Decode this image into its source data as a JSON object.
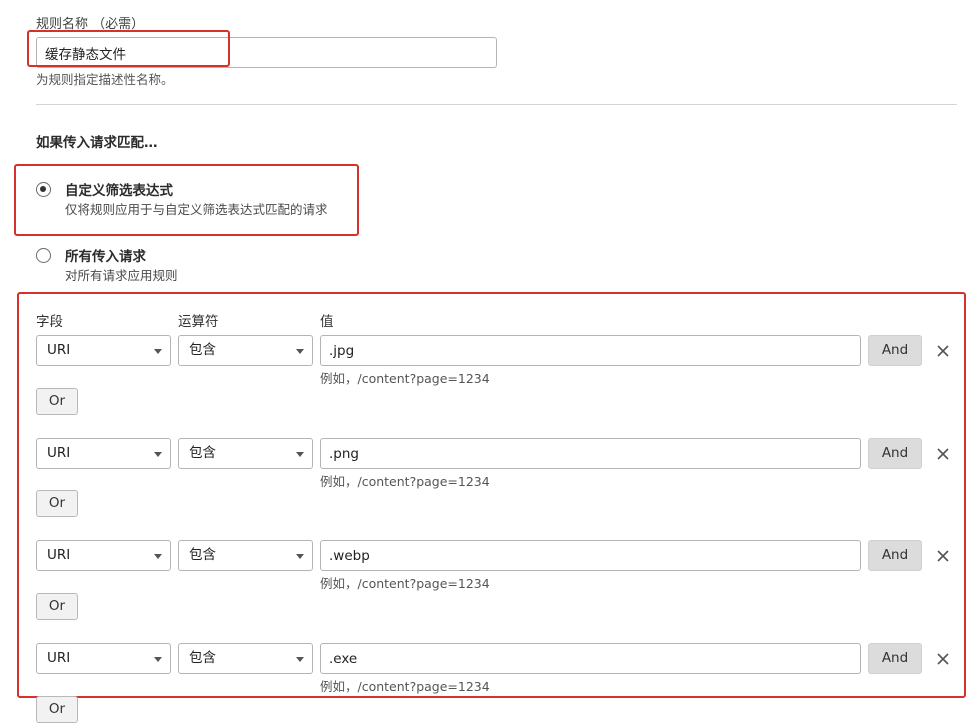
{
  "rule_name": {
    "label": "规则名称 （必需）",
    "value": "缓存静态文件",
    "help": "为规则指定描述性名称。"
  },
  "match": {
    "heading": "如果传入请求匹配…",
    "options": [
      {
        "title": "自定义筛选表达式",
        "desc": "仅将规则应用于与自定义筛选表达式匹配的请求",
        "checked": true
      },
      {
        "title": "所有传入请求",
        "desc": "对所有请求应用规则",
        "checked": false
      }
    ]
  },
  "expression": {
    "col_field": "字段",
    "col_operator": "运算符",
    "col_value": "值",
    "and_label": "And",
    "or_label": "Or",
    "example": "例如，/content?page=1234",
    "rows": [
      {
        "field": "URI",
        "operator": "包含",
        "value": ".jpg"
      },
      {
        "field": "URI",
        "operator": "包含",
        "value": ".png"
      },
      {
        "field": "URI",
        "operator": "包含",
        "value": ".webp"
      },
      {
        "field": "URI",
        "operator": "包含",
        "value": ".exe"
      }
    ]
  },
  "colors": {
    "highlight": "#d6322b",
    "and_button_bg": "#dcdcdc"
  }
}
